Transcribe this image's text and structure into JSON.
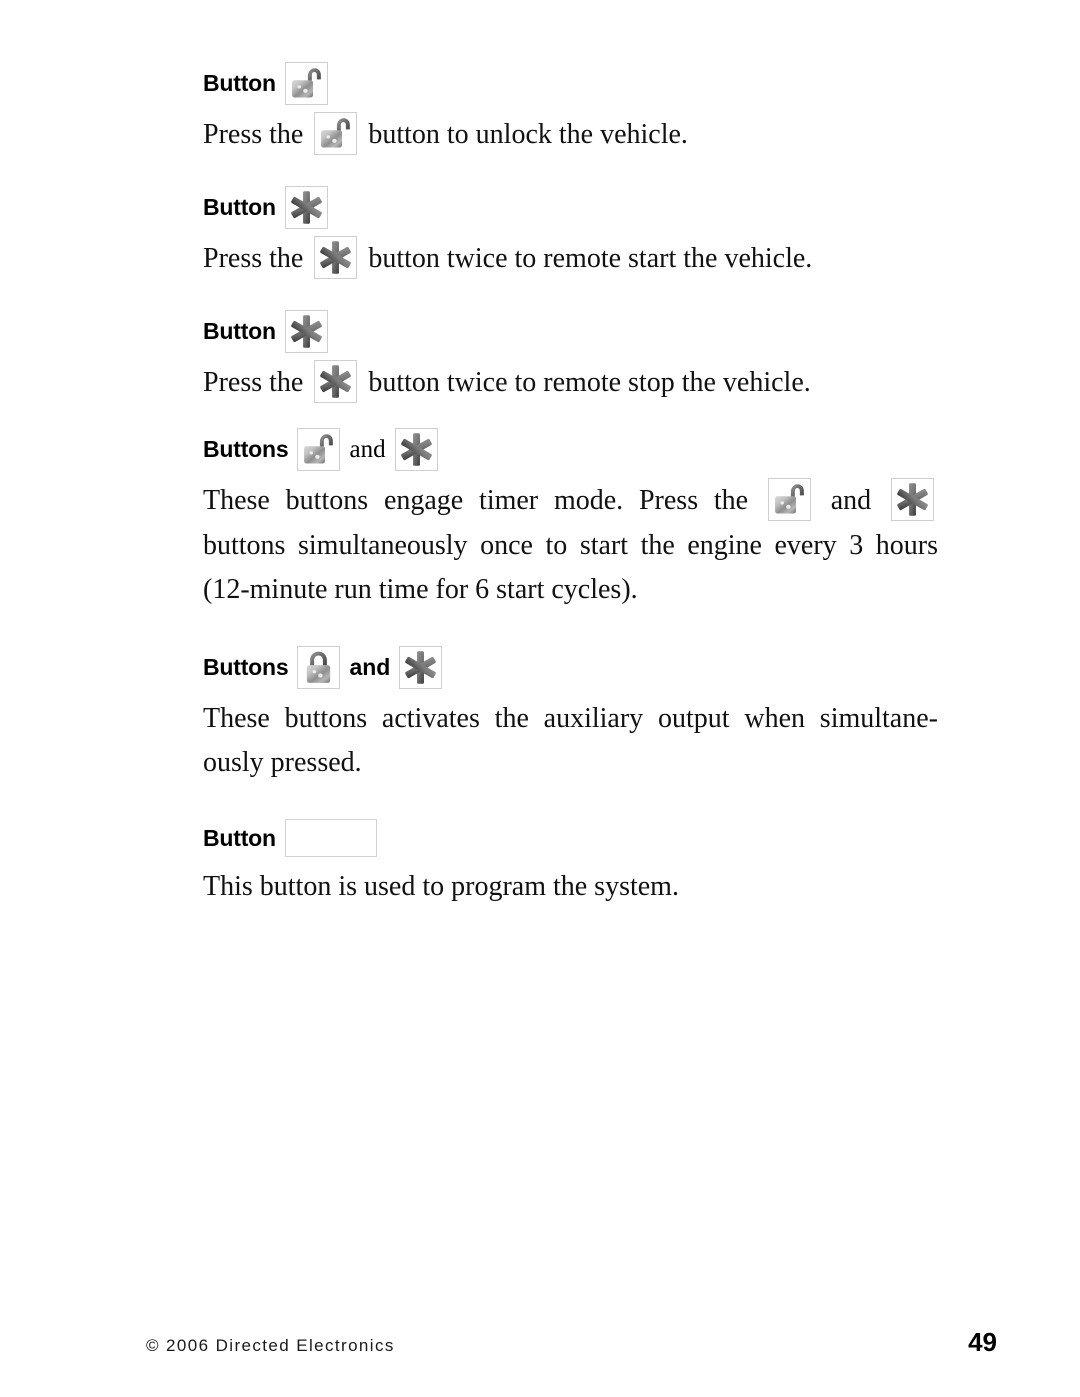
{
  "document": {
    "page_number": "49",
    "copyright": "© 2006 Directed Electronics"
  },
  "icons": {
    "unlock": "unlock-padlock-icon",
    "lock": "lock-padlock-icon",
    "star": "asterisk-star-icon",
    "blank": "blank-button-icon"
  },
  "colors": {
    "chip_border": "#cfcfcf",
    "icon_gray_light": "#e8e8e8",
    "icon_gray_mid": "#9a9a9a",
    "icon_gray_dark": "#5a5a5a",
    "text": "#000000"
  },
  "sections": [
    {
      "heading_label": "Button",
      "heading_icons": [
        "unlock"
      ],
      "conjunction": "",
      "body_before": "Press the ",
      "body_icons": [
        "unlock"
      ],
      "body_after": " button to unlock the vehicle.",
      "align": "left"
    },
    {
      "heading_label": "Button",
      "heading_icons": [
        "star"
      ],
      "conjunction": "",
      "body_before": "Press the ",
      "body_icons": [
        "star"
      ],
      "body_after": " button twice to remote start the vehicle.",
      "align": "left"
    },
    {
      "heading_label": "Button",
      "heading_icons": [
        "star"
      ],
      "conjunction": "",
      "body_before": "Press the ",
      "body_icons": [
        "star"
      ],
      "body_after": " button twice to remote stop the vehicle.",
      "align": "left"
    },
    {
      "heading_label": "Buttons",
      "heading_icons": [
        "unlock",
        "star"
      ],
      "conjunction": "and",
      "conjunction_style": "serif",
      "body_before": "These buttons engage timer mode. Press the ",
      "body_mid": " and ",
      "body_icons": [
        "unlock",
        "star"
      ],
      "body_after": " buttons simultaneously once to start the engine every 3 hours (12-minute run time for 6 start cycles).",
      "align": "justify"
    },
    {
      "heading_label": "Buttons",
      "heading_icons": [
        "lock",
        "star"
      ],
      "conjunction": "and",
      "conjunction_style": "bold",
      "body_before": "These buttons activates the auxiliary output when simultane-ously pressed.",
      "body_icons": [],
      "body_after": "",
      "align": "justify"
    },
    {
      "heading_label": "Button",
      "heading_icons": [
        "blank"
      ],
      "conjunction": "",
      "body_before": "This button is used to program the system.",
      "body_icons": [],
      "body_after": "",
      "align": "left"
    }
  ]
}
